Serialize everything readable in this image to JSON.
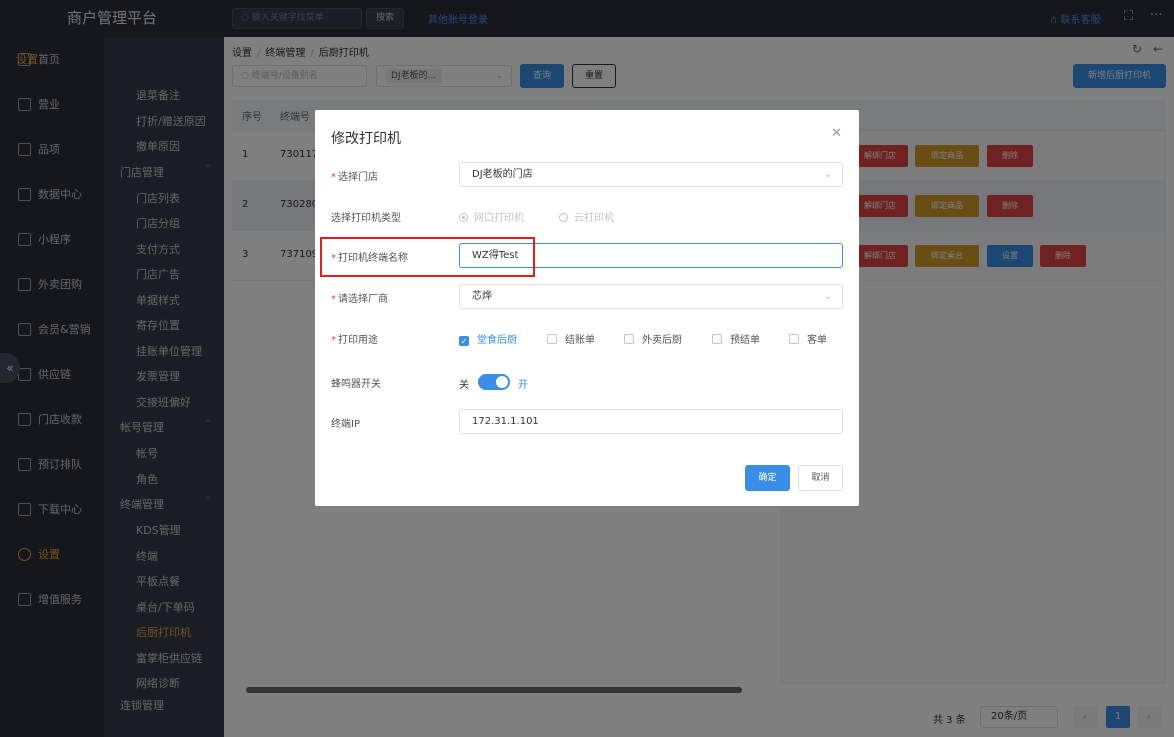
{
  "app": {
    "title": "商户管理平台"
  },
  "topbar": {
    "search_placeholder": "输入关键字找菜单",
    "search_button": "搜索",
    "other_login": "其他账号登录",
    "contact": "联系客服"
  },
  "nav": [
    {
      "label": "首页",
      "icon": "home-icon"
    },
    {
      "label": "营业",
      "icon": "calendar-icon"
    },
    {
      "label": "品项",
      "icon": "bag-icon"
    },
    {
      "label": "数据中心",
      "icon": "share-icon"
    },
    {
      "label": "小程序",
      "icon": "phone-icon"
    },
    {
      "label": "外卖团购",
      "icon": "group-icon"
    },
    {
      "label": "会员&营销",
      "icon": "user-icon"
    },
    {
      "label": "供应链",
      "icon": "truck-icon"
    },
    {
      "label": "门店收款",
      "icon": "coin-icon"
    },
    {
      "label": "预订排队",
      "icon": "clock-icon"
    },
    {
      "label": "下载中心",
      "icon": "download-icon"
    },
    {
      "label": "设置",
      "icon": "gear-icon"
    },
    {
      "label": "增值服务",
      "icon": "alarm-icon"
    }
  ],
  "submenu": {
    "top": "设置",
    "items_a": [
      "退菜备注",
      "打折/赠送原因",
      "撤单原因"
    ],
    "group_store": "门店管理",
    "items_store": [
      "门店列表",
      "门店分组",
      "支付方式",
      "门店广告",
      "单据样式",
      "寄存位置",
      "挂账单位管理",
      "发票管理",
      "交接班偏好"
    ],
    "group_account": "帐号管理",
    "items_account": [
      "帐号",
      "角色"
    ],
    "group_terminal": "终端管理",
    "items_terminal": [
      "KDS管理",
      "终端",
      "平板点餐",
      "桌台/下单码",
      "后厨打印机",
      "富掌柜供应链",
      "网络诊断"
    ],
    "group_chain": "连锁管理"
  },
  "breadcrumb": [
    "设置",
    "终端管理",
    "后厨打印机"
  ],
  "filters": {
    "search_placeholder": "终端号/设备别名",
    "store_value": "DJ老板的...",
    "query": "查询",
    "reset": "重置",
    "add": "新增后厨打印机"
  },
  "table": {
    "headers": [
      "序号",
      "终端号"
    ],
    "rows": [
      {
        "no": "1",
        "terminal": "730117"
      },
      {
        "no": "2",
        "terminal": "730280"
      },
      {
        "no": "3",
        "terminal": "737109"
      }
    ],
    "actions": {
      "unbind_store": "解绑门店",
      "bind_goods": "绑定商品",
      "bind_table": "绑定桌台",
      "settings": "设置",
      "delete": "删除"
    }
  },
  "pager": {
    "total": "共 3 条",
    "size": "20条/页",
    "page": "1"
  },
  "dialog": {
    "title": "修改打印机",
    "store_label": "选择门店",
    "store_value": "DJ老板的门店",
    "type_label": "选择打印机类型",
    "type_options": [
      "网口打印机",
      "云打印机"
    ],
    "name_label": "打印机终端名称",
    "name_value": "WZ得Test",
    "vendor_label": "请选择厂商",
    "vendor_value": "芯烨",
    "usage_label": "打印用途",
    "usage_options": [
      "堂食后厨",
      "结账单",
      "外卖后厨",
      "预结单",
      "客单"
    ],
    "buzzer_label": "蜂鸣器开关",
    "buzzer_off": "关",
    "buzzer_on": "开",
    "ip_label": "终端IP",
    "ip_value": "172.31.1.101",
    "ok": "确定",
    "cancel": "取消"
  }
}
